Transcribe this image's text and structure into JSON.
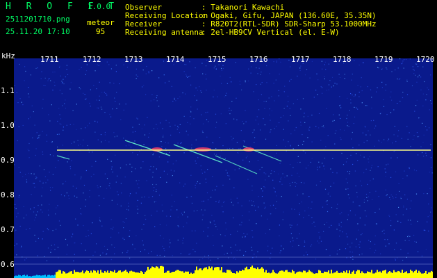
{
  "app": {
    "name": "H R O F F T",
    "version": "1.0.0",
    "filename": "2511201710.png",
    "datetime": "25.11.20 17:10",
    "meteor_label": "meteor",
    "meteor_count": "95"
  },
  "info": {
    "rows": [
      {
        "label": "Observer",
        "value": ": Takanori Kawachi"
      },
      {
        "label": "Receiving Location",
        "value": ": Ogaki, Gifu, JAPAN (136.60E, 35.35N)"
      },
      {
        "label": "Receiver",
        "value": ": R820T2(RTL-SDR) SDR-Sharp 53.1000MHz"
      },
      {
        "label": "Receiving antenna",
        "value": ": 2el-HB9CV Vertical (el. E-W)"
      }
    ]
  },
  "axis": {
    "unit": "kHz",
    "y_ticks": [
      "1.1",
      "1.0",
      "0.9",
      "0.8",
      "0.7",
      "0.6"
    ],
    "x_ticks": [
      "1711",
      "1712",
      "1713",
      "1714",
      "1715",
      "1716",
      "1717",
      "1718",
      "1719",
      "1720"
    ]
  },
  "colors": {
    "logo": "#00ff66",
    "header_text": "#ffff00",
    "background": "#0a1a8c",
    "carrier": "#ffff88",
    "histogram": "#ffff00"
  }
}
